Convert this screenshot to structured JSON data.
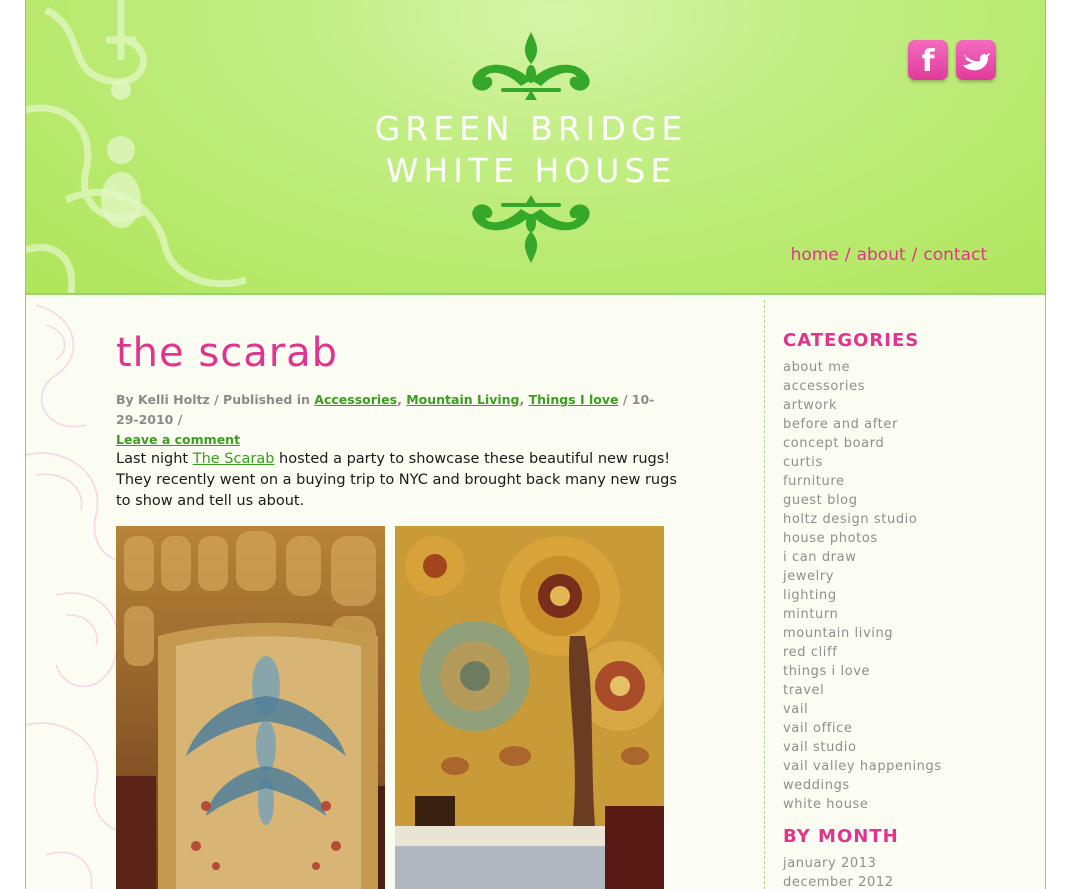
{
  "site": {
    "title_line1": "GREEN BRIDGE",
    "title_line2": "WHITE HOUSE"
  },
  "social": {
    "facebook_glyph": "f",
    "facebook_icon": "facebook-icon",
    "twitter_icon": "twitter-icon"
  },
  "nav": {
    "home": "home",
    "about": "about",
    "contact": "contact",
    "separator": "/"
  },
  "post": {
    "title": "the scarab",
    "meta_by": "By Kelli Holtz / Published in",
    "categories": [
      "Accessories",
      "Mountain Living",
      "Things I love"
    ],
    "date": "10-29-2010",
    "leave_comment": "Leave a comment",
    "body_prefix": "Last night",
    "body_link": "The Scarab",
    "body_suffix": "hosted a party to showcase these beautiful new rugs! They recently went on a buying trip to NYC and brought back many new rugs to show and tell us about."
  },
  "sidebar": {
    "categories_heading": "CATEGORIES",
    "categories": [
      "about me",
      "accessories",
      "artwork",
      "before and after",
      "concept board",
      "curtis",
      "furniture",
      "guest blog",
      "holtz design studio",
      "house photos",
      "i can draw",
      "jewelry",
      "lighting",
      "minturn",
      "mountain living",
      "red cliff",
      "things i love",
      "travel",
      "vail",
      "vail office",
      "vail studio",
      "vail valley happenings",
      "weddings",
      "white house"
    ],
    "month_heading": "BY MONTH",
    "months": [
      "january 2013",
      "december 2012"
    ]
  },
  "colors": {
    "header_green": "#afe55a",
    "accent_pink": "#e2338f",
    "link_green": "#3a9e1f",
    "ornament_green": "#35a82a"
  }
}
